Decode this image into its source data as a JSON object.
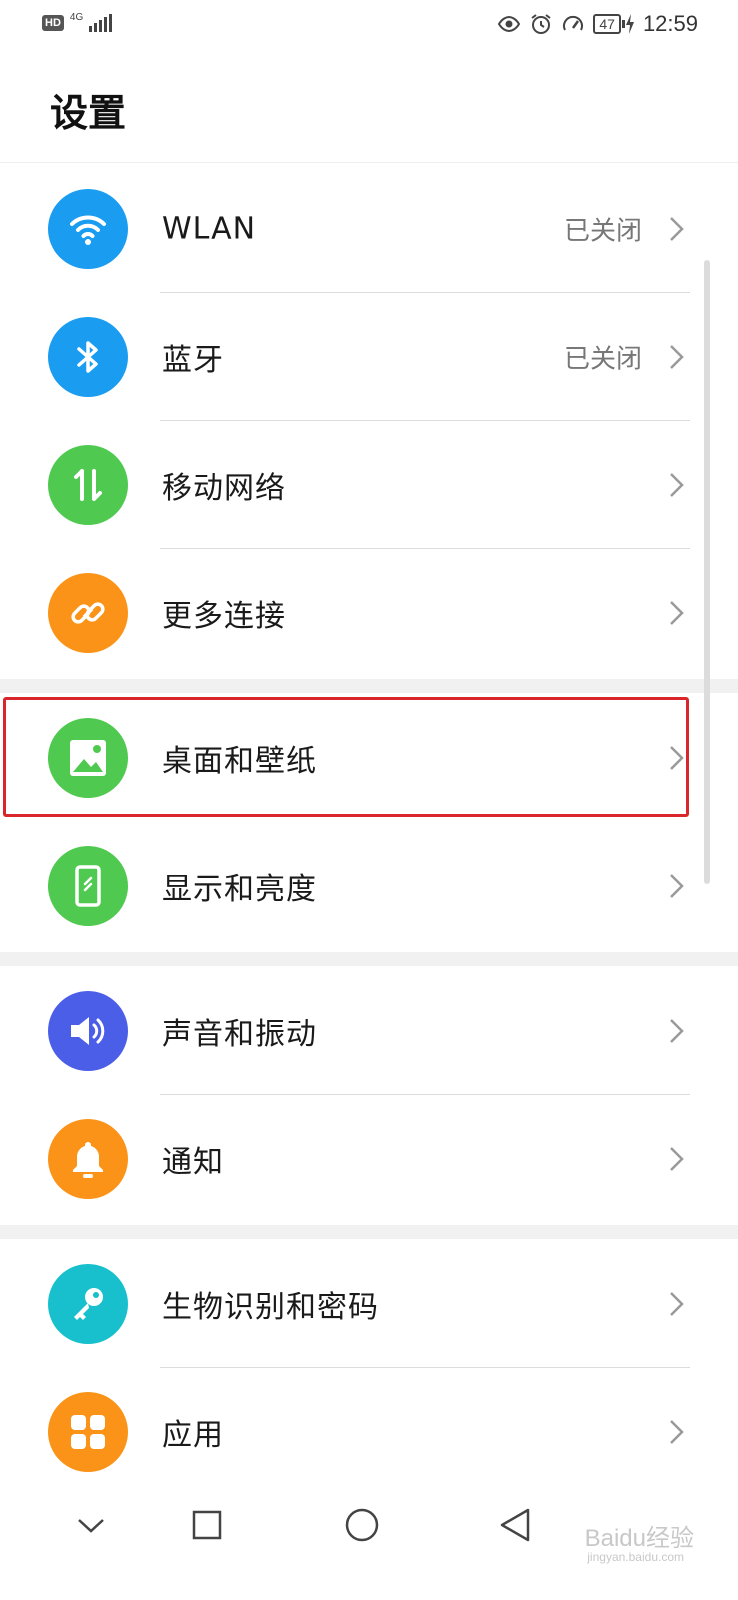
{
  "status_bar": {
    "hd_label": "HD",
    "network_label": "4G",
    "battery_level": "47",
    "time": "12:59"
  },
  "page_title": "设置",
  "settings": [
    {
      "label": "WLAN",
      "value": "已关闭",
      "icon": "wifi-icon",
      "color": "#1a9df0"
    },
    {
      "label": "蓝牙",
      "value": "已关闭",
      "icon": "bluetooth-icon",
      "color": "#1a9df0"
    },
    {
      "label": "移动网络",
      "value": "",
      "icon": "mobile-data-icon",
      "color": "#4fc950"
    },
    {
      "label": "更多连接",
      "value": "",
      "icon": "link-icon",
      "color": "#fb9318"
    },
    {
      "label": "桌面和壁纸",
      "value": "",
      "icon": "wallpaper-icon",
      "color": "#4fc950"
    },
    {
      "label": "显示和亮度",
      "value": "",
      "icon": "phone-brightness-icon",
      "color": "#4fc950"
    },
    {
      "label": "声音和振动",
      "value": "",
      "icon": "speaker-icon",
      "color": "#4a5ee8"
    },
    {
      "label": "通知",
      "value": "",
      "icon": "bell-icon",
      "color": "#fb9318"
    },
    {
      "label": "生物识别和密码",
      "value": "",
      "icon": "key-icon",
      "color": "#17c0cc"
    },
    {
      "label": "应用",
      "value": "",
      "icon": "apps-grid-icon",
      "color": "#fb9318"
    }
  ],
  "highlighted_item": "桌面和壁纸",
  "watermark": {
    "text": "Baidu经验",
    "sub": "jingyan.baidu.com"
  },
  "nav": [
    "collapse-icon",
    "recents-icon",
    "home-icon",
    "back-icon"
  ]
}
